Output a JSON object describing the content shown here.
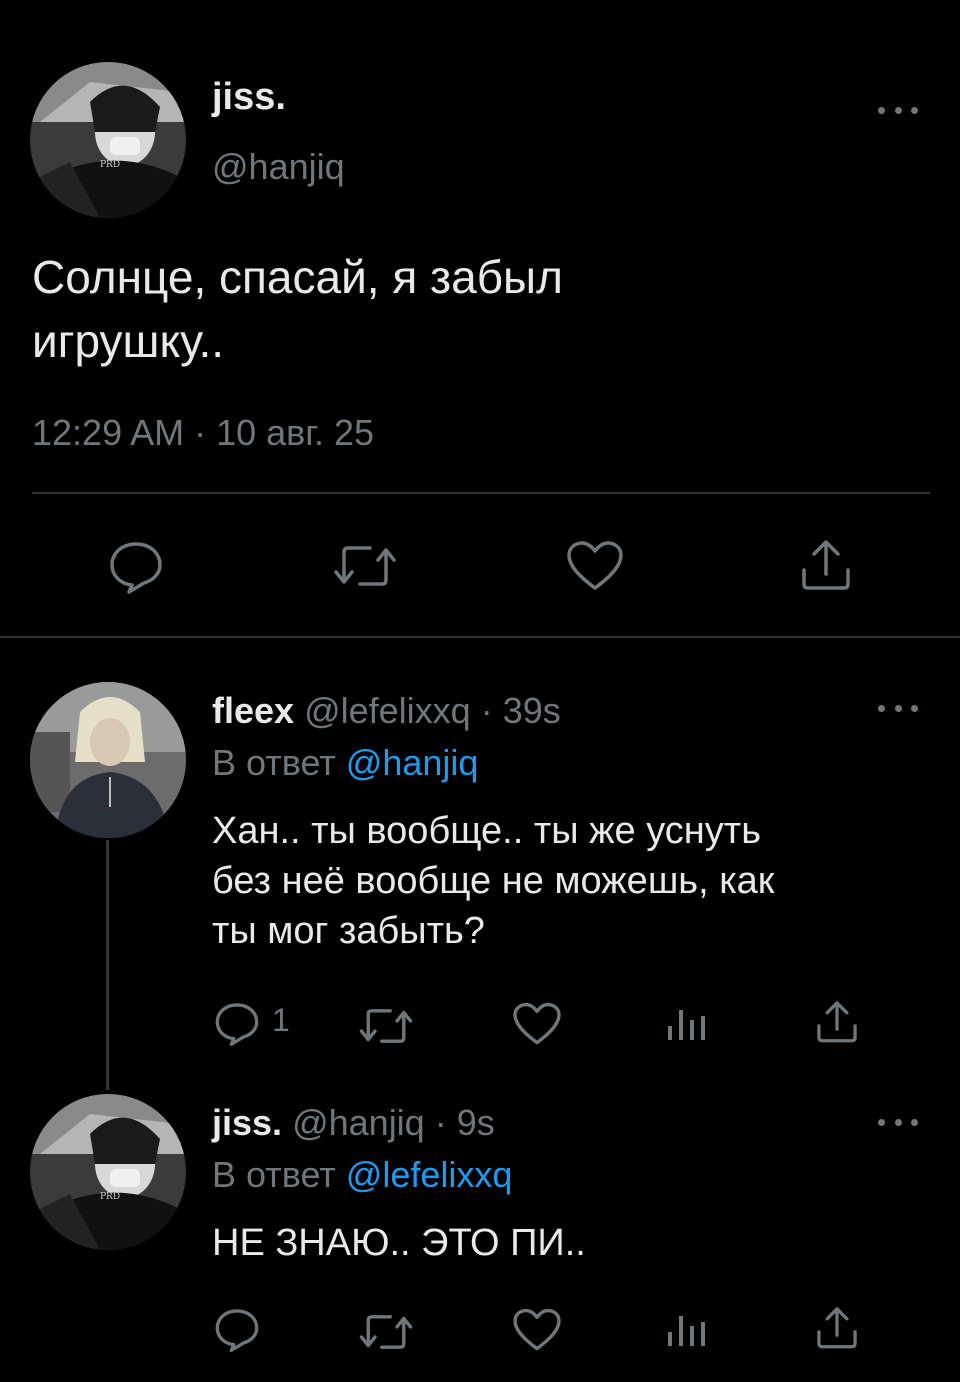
{
  "main_tweet": {
    "display_name": "jiss.",
    "handle": "@hanjiq",
    "text_line1": "Солнце, спасай, я забыл",
    "text_line2": "игрушку..",
    "timestamp": "12:29 AM · 10 авг. 25",
    "actions": [
      "reply-icon",
      "retweet-icon",
      "like-icon",
      "share-icon"
    ]
  },
  "reply1": {
    "display_name": "fleex",
    "handle": "@lefelixxq",
    "age": "· 39s",
    "reply_prefix": "В ответ",
    "reply_to": "@hanjiq",
    "text_line1": "Хан.. ты вообще.. ты же уснуть",
    "text_line2": "без неё вообще не можешь, как",
    "text_line3": "ты мог забыть?",
    "reply_count": "1"
  },
  "reply2": {
    "display_name": "jiss.",
    "handle": "@hanjiq",
    "age": "· 9s",
    "reply_prefix": "В ответ",
    "reply_to": "@lefelixxq",
    "text_line1": "НЕ ЗНАЮ.. ЭТО ПИ.."
  },
  "colors": {
    "background": "#000000",
    "text": "#e7e9ea",
    "muted": "#71767b",
    "link": "#1d9bf0",
    "divider": "#2f3336"
  }
}
